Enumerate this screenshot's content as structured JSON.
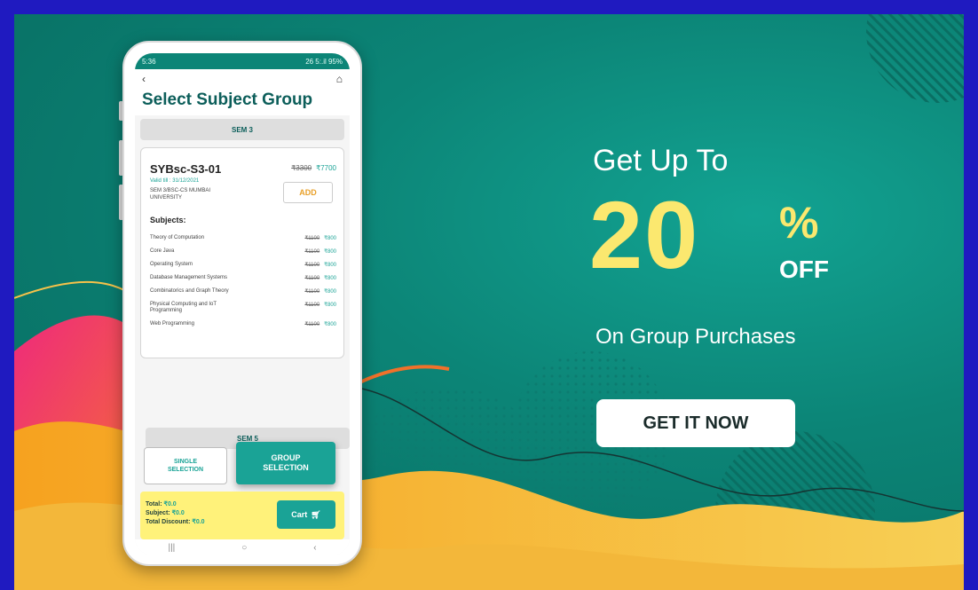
{
  "colors": {
    "brand_teal": "#0c8577",
    "accent_yellow": "#fbe86f",
    "border_blue": "#1f1ac0"
  },
  "phone": {
    "status_left": "5:36",
    "status_right": "26 5:.il 95%",
    "back_icon": "chevron-left-icon",
    "home_icon": "home-icon",
    "title": "Select Subject Group",
    "sem_header_1": "SEM 3",
    "group": {
      "name": "SYBsc-S3-01",
      "original_price": "₹3300",
      "price": "₹7700",
      "valid": "Valid till : 31/12/2021",
      "university": "SEM 3/BSC-CS MUMBAI UNIVERSITY",
      "add_label": "ADD",
      "subjects_heading": "Subjects:",
      "subjects": [
        {
          "name": "Theory of Computation",
          "old": "₹1100",
          "new": "₹800"
        },
        {
          "name": "Core Java",
          "old": "₹1100",
          "new": "₹800"
        },
        {
          "name": "Operating System",
          "old": "₹1100",
          "new": "₹800"
        },
        {
          "name": "Database Management Systems",
          "old": "₹1100",
          "new": "₹800"
        },
        {
          "name": "Combinatorics and Graph Theory",
          "old": "₹1100",
          "new": "₹800"
        },
        {
          "name": "Physical Computing and IoT Programming",
          "old": "₹1100",
          "new": "₹800"
        },
        {
          "name": "Web Programming",
          "old": "₹1100",
          "new": "₹800"
        }
      ]
    },
    "sem_header_2": "SEM 5",
    "single_selection": "SINGLE\nSELECTION",
    "group_selection": "GROUP\nSELECTION",
    "total_label": "Total:",
    "total_value": "₹0.0",
    "subject_label": "Subject:",
    "subject_value": "₹0.0",
    "discount_label": "Total Discount:",
    "discount_value": "₹0.0",
    "cart_label": "Cart"
  },
  "promo": {
    "line1": "Get Up To",
    "number": "20",
    "percent": "%",
    "off": "OFF",
    "subline": "On Group Purchases",
    "cta": "GET IT NOW"
  }
}
